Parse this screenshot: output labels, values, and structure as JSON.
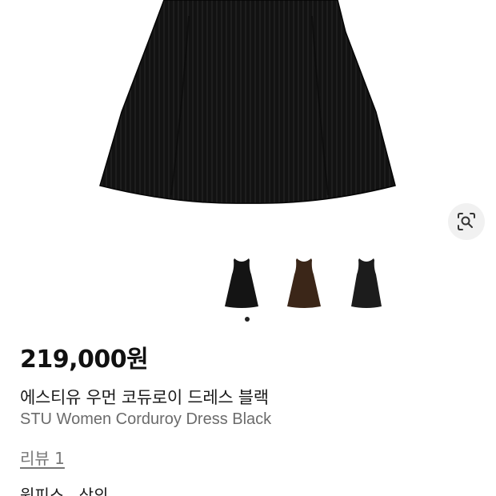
{
  "product": {
    "price": "219,000원",
    "name_ko": "에스티유 우먼 코듀로이 드레스 블랙",
    "name_en": "STU Women Corduroy Dress Black",
    "review_link": "리뷰 1",
    "categories": [
      "원피스",
      "상의"
    ],
    "category_separator": ","
  },
  "gallery": {
    "selected_index": 0,
    "thumbnails": [
      {
        "name": "black dress",
        "color": "#141414"
      },
      {
        "name": "brown dress",
        "color": "#3b2618"
      },
      {
        "name": "charcoal dress",
        "color": "#1c1c1c"
      }
    ],
    "dot_count": 1
  },
  "icons": {
    "lens": "lens-search-icon"
  },
  "colors": {
    "dress": "#111111",
    "price_text": "#111111",
    "secondary_text": "#6b6b6b"
  }
}
